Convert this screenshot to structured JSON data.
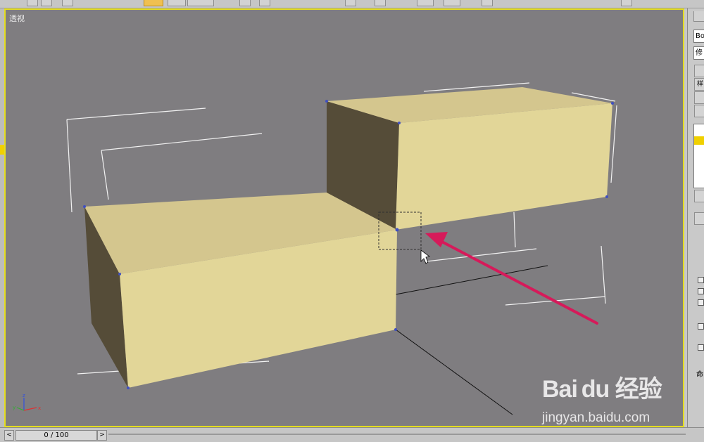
{
  "viewport": {
    "label": "透视"
  },
  "axes": {
    "x": "x",
    "y": "y",
    "z": "z"
  },
  "right_panel": {
    "object_name": "Box",
    "modifier_list": "修",
    "buttons": [
      "",
      "样",
      "",
      "",
      "",
      ""
    ],
    "extra_label": "命"
  },
  "timeline": {
    "frame_display": "0 / 100",
    "prev": "<",
    "next": ">"
  },
  "watermark": {
    "brand": "Bai du 经验",
    "url": "jingyan.baidu.com"
  },
  "colors": {
    "viewport_bg": "#7f7d80",
    "active_border": "#e4dd20",
    "box_top": "#d4c68e",
    "box_front": "#e2d698",
    "box_side": "#554c38",
    "arrow": "#d61a5a"
  }
}
